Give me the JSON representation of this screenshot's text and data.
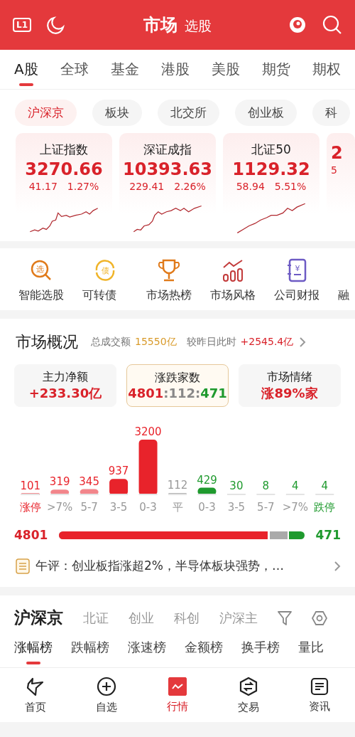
{
  "header": {
    "badge": "L1",
    "title": "市场",
    "subtitle": "选股"
  },
  "tabs": [
    {
      "label": "A股",
      "selected": true
    },
    {
      "label": "全球",
      "selected": false
    },
    {
      "label": "基金",
      "selected": false
    },
    {
      "label": "港股",
      "selected": false
    },
    {
      "label": "美股",
      "selected": false
    },
    {
      "label": "期货",
      "selected": false
    },
    {
      "label": "期权",
      "selected": false
    }
  ],
  "chips": [
    {
      "label": "沪深京",
      "selected": true
    },
    {
      "label": "板块",
      "selected": false
    },
    {
      "label": "北交所",
      "selected": false
    },
    {
      "label": "创业板",
      "selected": false
    },
    {
      "label": "科",
      "selected": false
    }
  ],
  "index_cards": [
    {
      "name": "上证指数",
      "value": "3270.66",
      "change": "41.17",
      "percent": "1.27%"
    },
    {
      "name": "深证成指",
      "value": "10393.63",
      "change": "229.41",
      "percent": "2.26%"
    },
    {
      "name": "北证50",
      "value": "1129.32",
      "change": "58.94",
      "percent": "5.51%"
    },
    {
      "value": "2",
      "change": "5"
    }
  ],
  "shortcuts": [
    {
      "label": "智能选股",
      "kind": "search",
      "glyph": "选"
    },
    {
      "label": "可转债",
      "kind": "cycle",
      "glyph": "债"
    },
    {
      "label": "市场热榜",
      "kind": "trophy"
    },
    {
      "label": "市场风格",
      "kind": "chart"
    },
    {
      "label": "公司财报",
      "kind": "ledger",
      "glyph": "¥"
    },
    {
      "label": "融",
      "kind": "none"
    }
  ],
  "overview": {
    "title": "市场概况",
    "turnover_label": "总成交额",
    "turnover": "15550亿",
    "compare_label": "较昨日此时",
    "compare": "+2545.4亿",
    "cards": [
      {
        "title": "主力净额",
        "selected": false,
        "parts": [
          {
            "text": "+233.30亿",
            "kind": "up"
          }
        ]
      },
      {
        "title": "涨跌家数",
        "selected": true,
        "parts": [
          {
            "text": "4801",
            "kind": "up"
          },
          {
            "text": ":",
            "kind": "flat"
          },
          {
            "text": "112",
            "kind": "flat"
          },
          {
            "text": ":",
            "kind": "flat"
          },
          {
            "text": "471",
            "kind": "down"
          }
        ]
      },
      {
        "title": "市场情绪",
        "selected": false,
        "parts": [
          {
            "text": "涨89%家",
            "kind": "up"
          }
        ]
      }
    ],
    "chart_data": {
      "type": "bar",
      "categories": [
        "涨停",
        ">7%",
        "5-7",
        "3-5",
        "0-3",
        "平",
        "0-3",
        "3-5",
        "5-7",
        ">7%",
        "跌停"
      ],
      "data_labels": true,
      "series": [
        {
          "color": "#e8232b",
          "values": [
            101,
            319,
            345,
            937,
            3200,
            null,
            null,
            null,
            null,
            null,
            null
          ]
        },
        {
          "color": "#999999",
          "values": [
            null,
            null,
            null,
            null,
            null,
            112,
            null,
            null,
            null,
            null,
            null
          ]
        },
        {
          "color": "#1f9a2e",
          "values": [
            null,
            null,
            null,
            null,
            null,
            null,
            429,
            30,
            8,
            4,
            4
          ]
        }
      ]
    },
    "ratio": {
      "up": "4801",
      "down": "471",
      "level": 0.86
    },
    "comment": {
      "text": "午评：创业板指涨超2%，半导体板块强势，…"
    }
  },
  "board": {
    "title": "沪深京",
    "tabs": [
      {
        "label": "北证"
      },
      {
        "label": "创业"
      },
      {
        "label": "科创"
      },
      {
        "label": "沪深主"
      }
    ],
    "rank_tabs": [
      {
        "label": "涨幅榜",
        "selected": true
      },
      {
        "label": "跌幅榜",
        "selected": false
      },
      {
        "label": "涨速榜",
        "selected": false
      },
      {
        "label": "金额榜",
        "selected": false
      },
      {
        "label": "换手榜",
        "selected": false
      },
      {
        "label": "量比",
        "selected": false
      }
    ]
  },
  "nav": [
    {
      "label": "首页",
      "kind": "home",
      "selected": false
    },
    {
      "label": "自选",
      "kind": "add",
      "selected": false
    },
    {
      "label": "行情",
      "kind": "market",
      "selected": true
    },
    {
      "label": "交易",
      "kind": "trade",
      "selected": false
    },
    {
      "label": "资讯",
      "kind": "news",
      "selected": false
    }
  ]
}
